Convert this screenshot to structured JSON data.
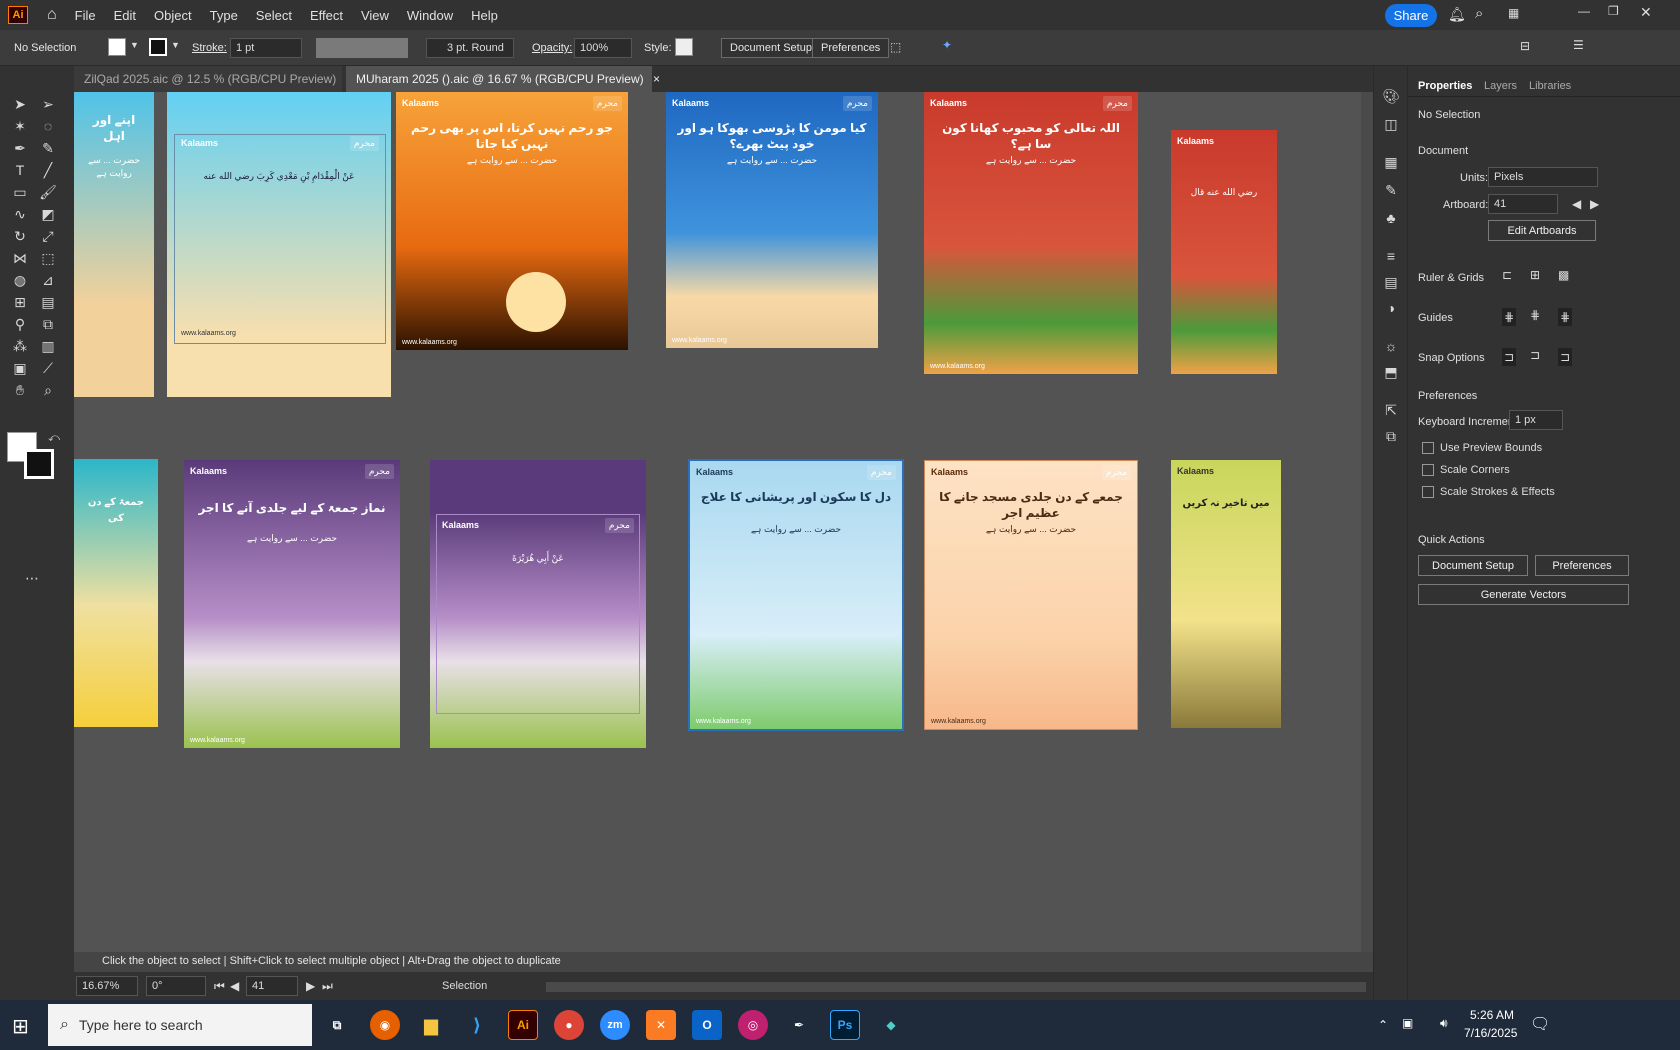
{
  "menu": {
    "app_logo": "Ai",
    "items": [
      "File",
      "Edit",
      "Object",
      "Type",
      "Select",
      "Effect",
      "View",
      "Window",
      "Help"
    ],
    "share": "Share"
  },
  "control": {
    "selection": "No Selection",
    "stroke_label": "Stroke:",
    "stroke_value": "1 pt",
    "brush_value": "3 pt. Round",
    "opacity_label": "Opacity:",
    "opacity_value": "100%",
    "style_label": "Style:",
    "document_setup": "Document Setup",
    "preferences": "Preferences"
  },
  "tabs": [
    {
      "label": "ZilQad 2025.aic @ 12.5 % (RGB/CPU Preview)",
      "active": false
    },
    {
      "label": "MUharam 2025 ().aic @ 16.67 % (RGB/CPU Preview)",
      "active": true
    }
  ],
  "artboards": {
    "brand": "Kalaams",
    "calendar": "محرم",
    "footer": "www.kalaams.org",
    "row1": [
      {
        "title": "اپنے اور اہل ",
        "color_top": "#4fc3e8",
        "color_bottom": "#f3d19a"
      },
      {
        "title": "عَنْ الْمِقْدَامِ بْنِ مَعْدِي كَرِبَ رضي الله عنه",
        "color_top": "#62d0f3",
        "color_bottom": "#f7dfae"
      },
      {
        "title": "جو رحم نہیں کرتا، اس پر بھی رحم نہیں کیا جاتا",
        "color_top": "#f39a2a",
        "color_bottom": "#e86a10"
      },
      {
        "title": "کیا مومن کا پڑوسی بھوکا ہو اور خود پیٹ بھرے؟",
        "color_top": "#1f68c1",
        "color_bottom": "#6fc7ef"
      },
      {
        "title": "اللہ تعالی کو محبوب کھانا کون سا ہے؟",
        "color_top": "#c93a2c",
        "color_bottom": "#f0a247"
      },
      {
        "title": "رضي الله عنه قال",
        "color_top": "#c93a2c",
        "color_bottom": "#f0a247"
      }
    ],
    "row2": [
      {
        "title": "جمعۃ کے دن کی",
        "color_top": "#2bb6c9",
        "color_bottom": "#f5cf3b"
      },
      {
        "title": "نماز جمعۃ کے لیے جلدی آنے کا اجر",
        "color_top": "#5a3a7a",
        "color_bottom": "#9bc24f"
      },
      {
        "title": "عَنْ أَبِي هُرَيْرَةَ",
        "color_top": "#5a3a7a",
        "color_bottom": "#9bc24f"
      },
      {
        "title": "دل کا سکون اور پریشانی کا علاج",
        "color_top": "#a9d8f0",
        "color_bottom": "#7ecb6d"
      },
      {
        "title": "جمعے کے دن جلدی مسجد جانے کا عظیم اجر",
        "color_top": "#fde2c4",
        "color_bottom": "#f7b88a"
      },
      {
        "title": "میں تاخیر نہ کریں",
        "color_top": "#c8d65c",
        "color_bottom": "#f2e28a"
      }
    ],
    "body_text": "حضرت ... سے روایت ہے"
  },
  "properties": {
    "tabs": [
      "Properties",
      "Layers",
      "Libraries"
    ],
    "no_selection": "No Selection",
    "document": "Document",
    "units_label": "Units:",
    "units_value": "Pixels",
    "artboard_label": "Artboard:",
    "artboard_value": "41",
    "edit_artboards": "Edit Artboards",
    "ruler_grids": "Ruler & Grids",
    "guides": "Guides",
    "snap_options": "Snap Options",
    "preferences": "Preferences",
    "keyboard_increment_label": "Keyboard Increment:",
    "keyboard_increment_value": "1 px",
    "checks": [
      "Use Preview Bounds",
      "Scale Corners",
      "Scale Strokes & Effects"
    ],
    "quick_actions": "Quick Actions",
    "document_setup": "Document Setup",
    "preferences_btn": "Preferences",
    "generate_vectors": "Generate Vectors"
  },
  "status": {
    "hint": "Click the object to select  |  Shift+Click to select multiple object  |  Alt+Drag the object to duplicate",
    "zoom": "16.67%",
    "rotation": "0°",
    "artboard": "41",
    "tool": "Selection"
  },
  "taskbar": {
    "search_placeholder": "Type here to search",
    "time": "5:26 AM",
    "date": "7/16/2025"
  }
}
